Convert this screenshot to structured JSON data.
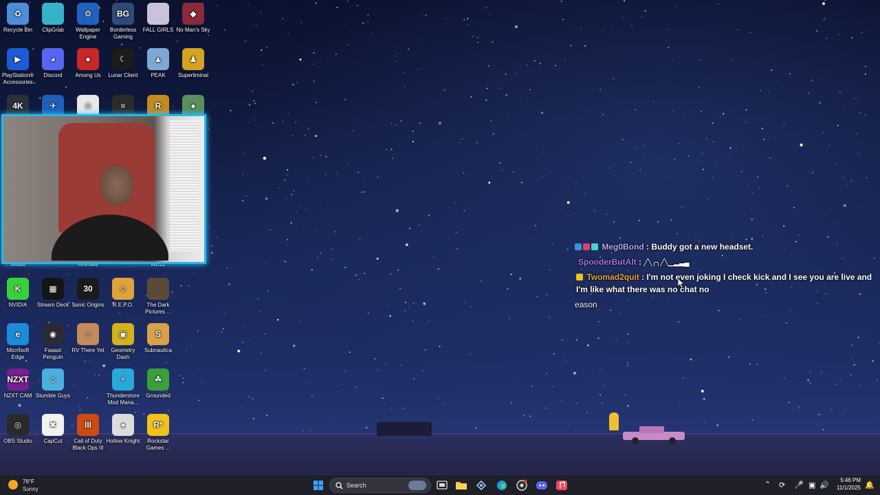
{
  "desktop": {
    "icons": [
      {
        "label": "Recycle Bin",
        "glyph": "♻",
        "color": "#4a8fd8"
      },
      {
        "label": "ClipGrab",
        "glyph": "",
        "color": "#35b3c9"
      },
      {
        "label": "Wallpaper Engine",
        "glyph": "⚙",
        "color": "#1e63c0"
      },
      {
        "label": "Borderless Gaming",
        "glyph": "BG",
        "color": "#2e4a7a"
      },
      {
        "label": "FALL GIRLS",
        "glyph": "",
        "color": "#c9c2d8"
      },
      {
        "label": "No Man's Sky",
        "glyph": "◆",
        "color": "#8a2a3a"
      },
      {
        "label": "PlayStation® Accessories",
        "glyph": "▶",
        "color": "#1c5bd6"
      },
      {
        "label": "Discord",
        "glyph": "◕",
        "color": "#5865f2"
      },
      {
        "label": "Among Us",
        "glyph": "●",
        "color": "#c62828"
      },
      {
        "label": "Lunar Client",
        "glyph": "☾",
        "color": "#1b1b1b"
      },
      {
        "label": "PEAK",
        "glyph": "▲",
        "color": "#7fa7d6"
      },
      {
        "label": "Superliminal",
        "glyph": "♟",
        "color": "#d6a21f"
      },
      {
        "label": "",
        "glyph": "4K",
        "color": "#2a2f3a"
      },
      {
        "label": "",
        "glyph": "✈",
        "color": "#1f5fb8"
      },
      {
        "label": "",
        "glyph": "☠",
        "color": "#e8e8e8"
      },
      {
        "label": "",
        "glyph": "≡",
        "color": "#2b2b2b"
      },
      {
        "label": "",
        "glyph": "R",
        "color": "#c48a1d"
      },
      {
        "label": "",
        "glyph": "●",
        "color": "#5b8f5b"
      },
      {
        "label": "Studio",
        "glyph": "",
        "color": "transparent"
      },
      {
        "label": "Animals",
        "glyph": "",
        "color": "transparent"
      },
      {
        "label": "WELL",
        "glyph": "",
        "color": "transparent"
      },
      {
        "label": "NVIDIA",
        "glyph": "K",
        "color": "#39d13a"
      },
      {
        "label": "Stream Deck",
        "glyph": "▦",
        "color": "#151515"
      },
      {
        "label": "Sonic Origins",
        "glyph": "30",
        "color": "#1a1a1a"
      },
      {
        "label": "R.E.P.O.",
        "glyph": "☺",
        "color": "#e0a23a"
      },
      {
        "label": "The Dark Pictures ...",
        "glyph": "",
        "color": "#5a4a3a"
      },
      {
        "label": "Microsoft Edge",
        "glyph": "e",
        "color": "#1c8bd8"
      },
      {
        "label": "Faaast Penguin",
        "glyph": "◉",
        "color": "#2a2a38"
      },
      {
        "label": "RV There Yet",
        "glyph": "☺",
        "color": "#c78a5a"
      },
      {
        "label": "Geometry Dash",
        "glyph": "▣",
        "color": "#d4b21c"
      },
      {
        "label": "Subnautica",
        "glyph": "S",
        "color": "#d8a24a"
      },
      {
        "label": "NZXT CAM",
        "glyph": "NZXT",
        "color": "#7a1f8f"
      },
      {
        "label": "Stumble Guys",
        "glyph": "☺",
        "color": "#4ab0e0"
      },
      {
        "label": "Thunderstore Mod Mana...",
        "glyph": "⚡",
        "color": "#29a9d8"
      },
      {
        "label": "Grounded",
        "glyph": "☘",
        "color": "#3aa03a"
      },
      {
        "label": "OBS Studio",
        "glyph": "◎",
        "color": "#2a2a2a"
      },
      {
        "label": "CapCut",
        "glyph": "✖",
        "color": "#f2f2f2"
      },
      {
        "label": "Call of Duty Black Ops III",
        "glyph": "III",
        "color": "#d04a10"
      },
      {
        "label": "Hollow Knight",
        "glyph": "♠",
        "color": "#dcdcdc"
      },
      {
        "label": "Rockstar Games ...",
        "glyph": "R*",
        "color": "#f2c21a"
      }
    ]
  },
  "chat": {
    "messages": [
      {
        "user": "Meg0Bond",
        "user_color": "#b8a7f0",
        "text": "Buddy got a new headset."
      },
      {
        "user": "SpooderButAlt",
        "user_color": "#a774e6",
        "text": "╱╲╭╮╱╲▁▂▃▄"
      },
      {
        "user": "Twomad2quit",
        "user_color": "#e8a33a",
        "text": "I'm not even joking I check kick and I see you are live and I'm like what there was no chat no"
      },
      {
        "user": "",
        "user_color": "#ffffff",
        "text": "eason"
      }
    ]
  },
  "taskbar": {
    "weather": {
      "temp": "76°F",
      "condition": "Sunny"
    },
    "search_placeholder": "Search",
    "clock": {
      "time": "5:46 PM",
      "date": "11/1/2025"
    },
    "pinned": [
      "start-icon",
      "search-icon",
      "task-view-icon",
      "file-explorer-icon",
      "steam-icon",
      "edge-icon",
      "chrome-icon",
      "discord-icon",
      "music-icon"
    ]
  },
  "colors": {
    "accent": "#28b6e8",
    "taskbar_bg": "#1f2027"
  }
}
